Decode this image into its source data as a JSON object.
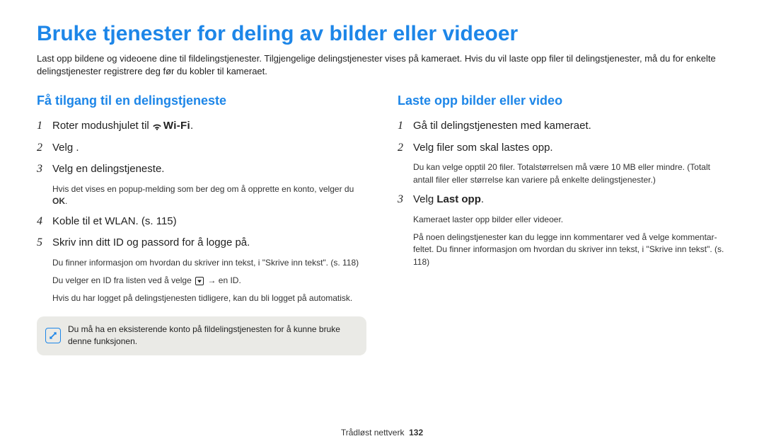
{
  "title": "Bruke tjenester for deling av bilder eller videoer",
  "intro": "Last opp bildene og videoene dine til fildelingstjenester. Tilgjengelige delingstjenester vises på kameraet. Hvis du vil laste opp filer til delingstjenester, må du for enkelte delingstjenester registrere deg før du kobler til kameraet.",
  "left": {
    "heading": "Få tilgang til en delingstjeneste",
    "s1_pre": "Roter modushjulet til ",
    "s1_post": ".",
    "s2": "Velg     .",
    "s3": "Velg en delingstjeneste.",
    "s3_sub_a": "Hvis det vises en popup-melding som ber deg om å opprette en konto, velger du ",
    "s3_sub_b": "OK",
    "s3_sub_c": ".",
    "s4": "Koble til et WLAN. (s. 115)",
    "s5": "Skriv inn ditt ID og passord for å logge på.",
    "s5_sub1": "Du finner informasjon om hvordan du skriver inn tekst, i \"Skrive inn tekst\". (s. 118)",
    "s5_sub2_a": "Du velger en ID fra listen ved å velge ",
    "s5_sub2_b": " → en ID.",
    "s5_sub3": "Hvis du har logget på delingstjenesten tidligere, kan du bli logget på automatisk.",
    "note": "Du må ha en eksisterende konto på fildelingstjenesten for å kunne bruke denne funksjonen.",
    "wifi_label": "Wi-Fi"
  },
  "right": {
    "heading": "Laste opp bilder eller video",
    "s1": "Gå til delingstjenesten med kameraet.",
    "s2": "Velg filer som skal lastes opp.",
    "s2_sub": "Du kan velge opptil 20 filer. Totalstørrelsen må være 10 MB eller mindre. (Totalt antall filer eller størrelse kan variere på enkelte delingstjenester.)",
    "s3_a": "Velg ",
    "s3_b": "Last opp",
    "s3_c": ".",
    "s3_sub1": "Kameraet laster opp bilder eller videoer.",
    "s3_sub2": "På noen delingstjenester kan du legge inn kommentarer ved å velge kommentar-feltet. Du finner informasjon om hvordan du skriver inn tekst, i \"Skrive inn tekst\". (s. 118)"
  },
  "footer": {
    "section": "Trådløst nettverk",
    "page": "132"
  },
  "nums": {
    "n1": "1",
    "n2": "2",
    "n3": "3",
    "n4": "4",
    "n5": "5"
  }
}
